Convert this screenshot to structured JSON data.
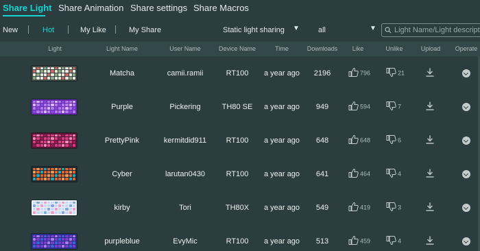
{
  "nav": {
    "tabs": [
      {
        "label": "Share Light",
        "active": true
      },
      {
        "label": "Share Animation",
        "active": false
      },
      {
        "label": "Share settings",
        "active": false
      },
      {
        "label": "Share Macros",
        "active": false
      }
    ]
  },
  "filters": {
    "new": "New",
    "hot": "Hot",
    "my_like": "My Like",
    "my_share": "My Share",
    "type_select": "Static light sharing",
    "scope_select": "all",
    "search_placeholder": "Light Name/Light description"
  },
  "table": {
    "headers": [
      "Light",
      "Light Name",
      "User Name",
      "Device Name",
      "Time",
      "Downloads",
      "Like",
      "Unlike",
      "Upload",
      "Operate"
    ],
    "rows": [
      {
        "light_name": "Matcha",
        "user": "camii.ramii",
        "device": "RT100",
        "time": "a year ago",
        "downloads": "2196",
        "like": "796",
        "unlike": "21",
        "palette": [
          "#e9ece4",
          "#8fa98a",
          "#c86b6b",
          "#3f4a45"
        ]
      },
      {
        "light_name": "Purple",
        "user": "Pickering",
        "device": "TH80 SE",
        "time": "a year ago",
        "downloads": "949",
        "like": "594",
        "unlike": "7",
        "palette": [
          "#b27be8",
          "#8a48d8",
          "#d9b8f5",
          "#6a2fb8"
        ]
      },
      {
        "light_name": "PrettyPink",
        "user": "kermitdid911",
        "device": "RT100",
        "time": "a year ago",
        "downloads": "648",
        "like": "648",
        "unlike": "6",
        "palette": [
          "#d43f86",
          "#8e1f52",
          "#f28bb8",
          "#5b1435"
        ]
      },
      {
        "light_name": "Cyber",
        "user": "larutan0430",
        "device": "RT100",
        "time": "a year ago",
        "downloads": "641",
        "like": "464",
        "unlike": "4",
        "palette": [
          "#e0662a",
          "#27a7b8",
          "#f09a4a",
          "#1d2a33"
        ]
      },
      {
        "light_name": "kirby",
        "user": "Tori",
        "device": "TH80X",
        "time": "a year ago",
        "downloads": "549",
        "like": "419",
        "unlike": "3",
        "palette": [
          "#c8d8f5",
          "#f19bc7",
          "#7fa6e0",
          "#eef3fb"
        ]
      },
      {
        "light_name": "purpleblue",
        "user": "EvyMic",
        "device": "RT100",
        "time": "a year ago",
        "downloads": "513",
        "like": "459",
        "unlike": "4",
        "palette": [
          "#7a3fd0",
          "#3b63d8",
          "#b07be8",
          "#2a2f8a"
        ]
      }
    ]
  },
  "colors": {
    "accent": "#19d4d4",
    "background": "#2b3d3f",
    "header_bg": "#33484a"
  }
}
